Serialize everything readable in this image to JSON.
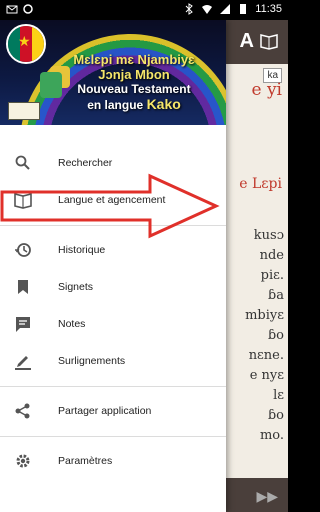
{
  "statusbar": {
    "time": "11:35",
    "icons": [
      "bluetooth-icon",
      "wifi-icon",
      "signal-icon",
      "battery-icon"
    ]
  },
  "background": {
    "title_fragment": "e yi",
    "heading_fragment": "e Lɛpi",
    "ka_badge": "ka",
    "lines": [
      "kusɔ",
      "nde",
      "piɛ.",
      "ɓa",
      "mbiyɛ",
      "ɓo",
      "nɛne.",
      "e nyɛ",
      "lɛ",
      "ɓo",
      "mo."
    ]
  },
  "drawer": {
    "header": {
      "line1": "Mɛlɛpi mɛ Njambiyɛ",
      "line2": "Jɔnja Mbon",
      "line3": "Nouveau Testament",
      "line4_prefix": "en langue",
      "line4_lang": "Kako"
    },
    "menu": [
      {
        "icon": "search-icon",
        "label": "Rechercher"
      },
      {
        "icon": "book-icon",
        "label": "Langue et agencement"
      },
      {
        "icon": "history-icon",
        "label": "Historique"
      },
      {
        "icon": "bookmark-icon",
        "label": "Signets"
      },
      {
        "icon": "note-icon",
        "label": "Notes"
      },
      {
        "icon": "highlight-icon",
        "label": "Surlignements"
      },
      {
        "icon": "share-icon",
        "label": "Partager application"
      },
      {
        "icon": "settings-icon",
        "label": "Paramètres"
      }
    ]
  },
  "colors": {
    "accent_red": "#e0302a",
    "toolbar": "#4a3f3b"
  }
}
